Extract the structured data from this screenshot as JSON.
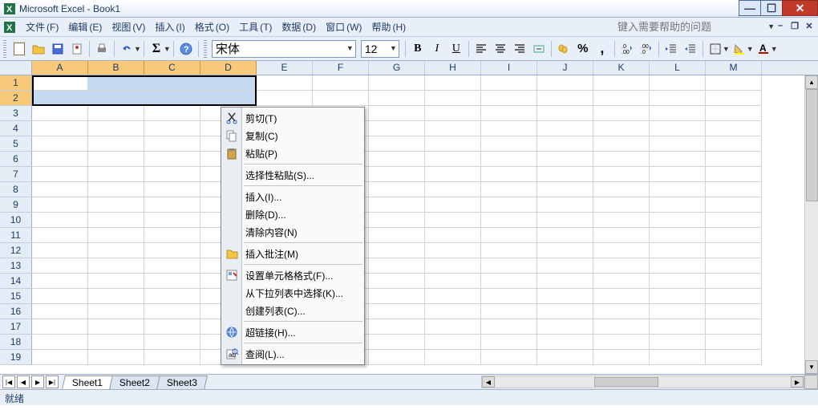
{
  "title": "Microsoft Excel - Book1",
  "menus": [
    {
      "label": "文件",
      "hk": "(F)"
    },
    {
      "label": "编辑",
      "hk": "(E)"
    },
    {
      "label": "视图",
      "hk": "(V)"
    },
    {
      "label": "插入",
      "hk": "(I)"
    },
    {
      "label": "格式",
      "hk": "(O)"
    },
    {
      "label": "工具",
      "hk": "(T)"
    },
    {
      "label": "数据",
      "hk": "(D)"
    },
    {
      "label": "窗口",
      "hk": "(W)"
    },
    {
      "label": "帮助",
      "hk": "(H)"
    }
  ],
  "help_placeholder": "键入需要帮助的问题",
  "font": {
    "name": "宋体",
    "size": "12"
  },
  "format_buttons": {
    "bold": "B",
    "italic": "I",
    "underline": "U",
    "currency": "%",
    "comma": ",",
    "percent": "%"
  },
  "columns": [
    "A",
    "B",
    "C",
    "D",
    "E",
    "F",
    "G",
    "H",
    "I",
    "J",
    "K",
    "L",
    "M"
  ],
  "selected_cols": [
    "A",
    "B",
    "C",
    "D"
  ],
  "rows": [
    1,
    2,
    3,
    4,
    5,
    6,
    7,
    8,
    9,
    10,
    11,
    12,
    13,
    14,
    15,
    16,
    17,
    18,
    19
  ],
  "selected_rows": [
    1,
    2
  ],
  "selection": {
    "active": "A1",
    "range": "A1:D2"
  },
  "sheets": [
    "Sheet1",
    "Sheet2",
    "Sheet3"
  ],
  "active_sheet": "Sheet1",
  "status": "就绪",
  "context_menu": [
    {
      "label": "剪切(T)",
      "icon": "cut"
    },
    {
      "label": "复制(C)",
      "icon": "copy"
    },
    {
      "label": "粘贴(P)",
      "icon": "paste"
    },
    {
      "sep": true
    },
    {
      "label": "选择性粘贴(S)..."
    },
    {
      "sep": true
    },
    {
      "label": "插入(I)..."
    },
    {
      "label": "删除(D)..."
    },
    {
      "label": "清除内容(N)"
    },
    {
      "sep": true
    },
    {
      "label": "插入批注(M)",
      "icon": "comment"
    },
    {
      "sep": true
    },
    {
      "label": "设置单元格格式(F)...",
      "icon": "format"
    },
    {
      "label": "从下拉列表中选择(K)..."
    },
    {
      "label": "创建列表(C)..."
    },
    {
      "sep": true
    },
    {
      "label": "超链接(H)...",
      "icon": "hyperlink"
    },
    {
      "sep": true
    },
    {
      "label": "查阅(L)...",
      "icon": "lookup"
    }
  ]
}
